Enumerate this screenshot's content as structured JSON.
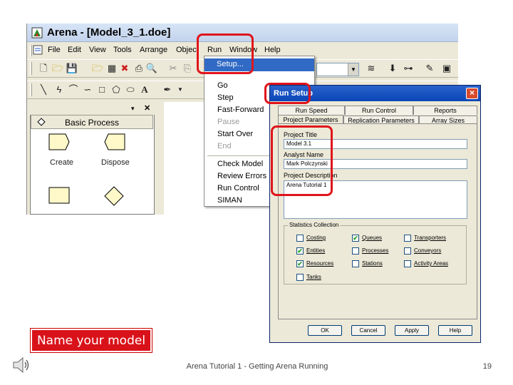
{
  "window": {
    "title": "Arena - [Model_3_1.doe]"
  },
  "menubar": [
    "File",
    "Edit",
    "View",
    "Tools",
    "Arrange",
    "Object",
    "Run",
    "Window",
    "Help"
  ],
  "project_bar": {
    "panel": "Basic Process",
    "modules": [
      "Create",
      "Dispose",
      "Process",
      "Decide"
    ]
  },
  "run_menu": {
    "items": [
      "Setup...",
      "Go",
      "Step",
      "Fast-Forward",
      "Pause",
      "Start Over",
      "End",
      "Check Model",
      "Review Errors",
      "Run Control",
      "SIMAN"
    ],
    "disabled": [
      "Pause",
      "End"
    ]
  },
  "run_setup": {
    "title": "Run Setup",
    "close": "x",
    "tabs_row1": [
      "Run Speed",
      "Run Control",
      "Reports"
    ],
    "tabs_row2": [
      "Project Parameters",
      "Replication Parameters",
      "Array Sizes"
    ],
    "project_title_label": "Project Title",
    "project_title": "Model 3.1",
    "analyst_label": "Analyst Name",
    "analyst": "Mark Polczynski",
    "description_label": "Project Description",
    "description": "Arena Tutorial 1",
    "stats_label": "Statistics Collection",
    "stats": [
      {
        "label": "Costing",
        "checked": false
      },
      {
        "label": "Queues",
        "checked": true
      },
      {
        "label": "Transporters",
        "checked": false
      },
      {
        "label": "Entities",
        "checked": true
      },
      {
        "label": "Processes",
        "checked": false
      },
      {
        "label": "Conveyors",
        "checked": false
      },
      {
        "label": "Resources",
        "checked": true
      },
      {
        "label": "Stations",
        "checked": false
      },
      {
        "label": "Activity Areas",
        "checked": false
      },
      {
        "label": "Tanks",
        "checked": false
      }
    ],
    "buttons": [
      "OK",
      "Cancel",
      "Apply",
      "Help"
    ]
  },
  "slide": {
    "caption": "Name your model",
    "footer": "Arena Tutorial 1 - Getting Arena Running",
    "page": "19"
  },
  "colors": {
    "highlight": "#e0151b",
    "caption_bg": "#d9121a",
    "menu_select": "#316ac5"
  }
}
